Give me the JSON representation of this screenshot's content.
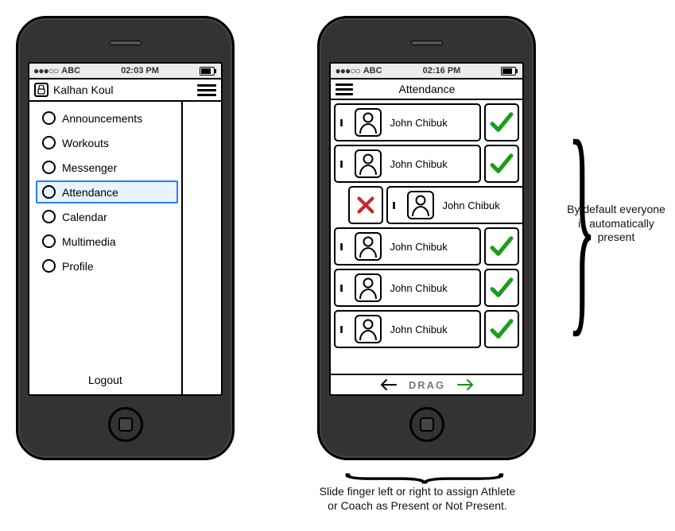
{
  "left_phone": {
    "statusbar": {
      "dots": "●●●○○",
      "carrier": "ABC",
      "time": "02:03 PM"
    },
    "header": {
      "user_name": "Kalhan Koul"
    },
    "menu": [
      {
        "label": "Announcements",
        "selected": false
      },
      {
        "label": "Workouts",
        "selected": false
      },
      {
        "label": "Messenger",
        "selected": false
      },
      {
        "label": "Attendance",
        "selected": true
      },
      {
        "label": "Calendar",
        "selected": false
      },
      {
        "label": "Multimedia",
        "selected": false
      },
      {
        "label": "Profile",
        "selected": false
      }
    ],
    "logout_label": "Logout"
  },
  "right_phone": {
    "statusbar": {
      "dots": "●●●○○",
      "carrier": "ABC",
      "time": "02:16 PM"
    },
    "title": "Attendance",
    "rows": [
      {
        "name": "John Chibuk",
        "status": "present"
      },
      {
        "name": "John Chibuk",
        "status": "present"
      },
      {
        "name": "John Chibuk",
        "status": "absent"
      },
      {
        "name": "John Chibuk",
        "status": "present"
      },
      {
        "name": "John Chibuk",
        "status": "present"
      },
      {
        "name": "John Chibuk",
        "status": "present"
      }
    ],
    "footer": {
      "label": "DRAG"
    }
  },
  "annotations": {
    "right": "By default everyone is automatically present",
    "bottom": "Slide finger left or right to assign Athlete or Coach as Present or Not Present."
  }
}
